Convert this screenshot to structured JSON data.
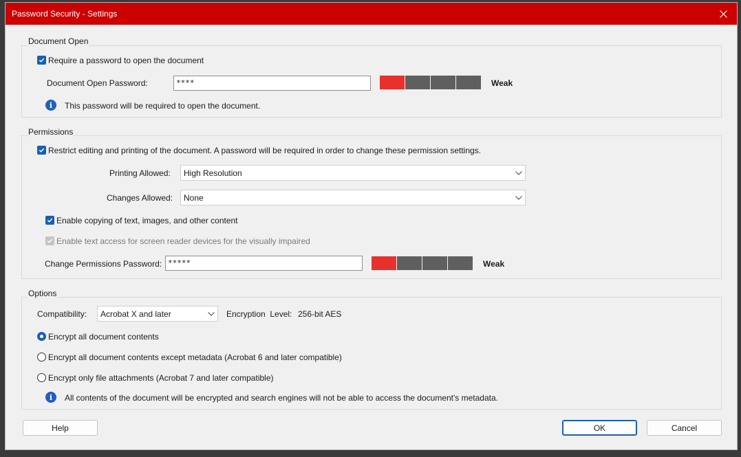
{
  "window": {
    "title": "Password Security - Settings"
  },
  "document_open": {
    "group_title": "Document Open",
    "require_password_label": "Require a password to open the document",
    "require_password_checked": true,
    "password_label": "Document Open Password:",
    "password_value": "****",
    "strength_level": 1,
    "strength_segments": 4,
    "strength_text": "Weak",
    "info_text": "This password will be required to open the document."
  },
  "permissions": {
    "group_title": "Permissions",
    "restrict_label": "Restrict editing and printing of the document. A password will be required in order to change these permission settings.",
    "restrict_checked": true,
    "printing_label": "Printing Allowed:",
    "printing_value": "High Resolution",
    "changes_label": "Changes Allowed:",
    "changes_value": "None",
    "copy_label": "Enable copying of text, images, and other content",
    "copy_checked": true,
    "screen_reader_label": "Enable text access for screen reader devices for the visually impaired",
    "screen_reader_checked": true,
    "screen_reader_disabled": true,
    "password_label": "Change Permissions Password:",
    "password_value": "*****",
    "strength_level": 1,
    "strength_segments": 4,
    "strength_text": "Weak"
  },
  "options": {
    "group_title": "Options",
    "compatibility_label": "Compatibility:",
    "compatibility_value": "Acrobat X and later",
    "encryption_label": "Encryption  Level:",
    "encryption_value": "256-bit AES",
    "radio_all": "Encrypt all document contents",
    "radio_except_metadata": "Encrypt all document contents except metadata (Acrobat 6 and later compatible)",
    "radio_attachments": "Encrypt only file attachments (Acrobat 7 and later compatible)",
    "selected_radio": "all",
    "info_text": "All contents of the document will be encrypted and search engines will not be able to access the document's metadata."
  },
  "buttons": {
    "help": "Help",
    "ok": "OK",
    "cancel": "Cancel"
  },
  "colors": {
    "title_bar": "#cc0000",
    "accent": "#1a5fb4",
    "strength_weak": "#e8302c",
    "strength_off": "#5f5f5f"
  },
  "icons": {
    "close": "close-icon",
    "info": "info-icon",
    "chevron": "chevron-down-icon",
    "check": "check-icon"
  }
}
